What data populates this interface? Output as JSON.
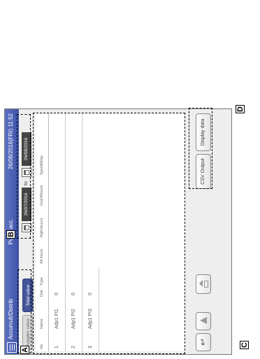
{
  "title_bar": {
    "title": "Accumult/Distrib",
    "center": "Pulse acc.",
    "datetime": "26/08/2016(FRI) 11:52"
  },
  "tabs": [
    {
      "label": "Adaptor value",
      "active": false
    },
    {
      "label": "Total value",
      "active": true
    }
  ],
  "date_range": {
    "from": "26/07/2016",
    "separator": "to",
    "to": "26/08/2016"
  },
  "table": {
    "columns": [
      "No.",
      "Name",
      "Dstr",
      "Type",
      "All hours",
      "RglrHours1",
      "OutOfHours",
      "SpecifdDay"
    ],
    "rows": [
      {
        "no": "1",
        "name": "Adp1 PI1",
        "dstr": "0"
      },
      {
        "no": "2",
        "name": "Adp1 PI2",
        "dstr": "0"
      },
      {
        "no": "3",
        "name": "Adp1 PI3",
        "dstr": "0"
      }
    ]
  },
  "footer": {
    "csv_label": "CSV Output",
    "display_label": "Display data"
  },
  "callouts": {
    "a": "A",
    "b": "B",
    "c": "C",
    "d": "D"
  },
  "icons": [
    "menu-icon",
    "calendar-icon",
    "back-icon",
    "home-icon",
    "navigation-icon"
  ],
  "colors": {
    "title_bar": "#4a5eb4",
    "active_tab": "#44549a",
    "date_box": "#444444"
  }
}
